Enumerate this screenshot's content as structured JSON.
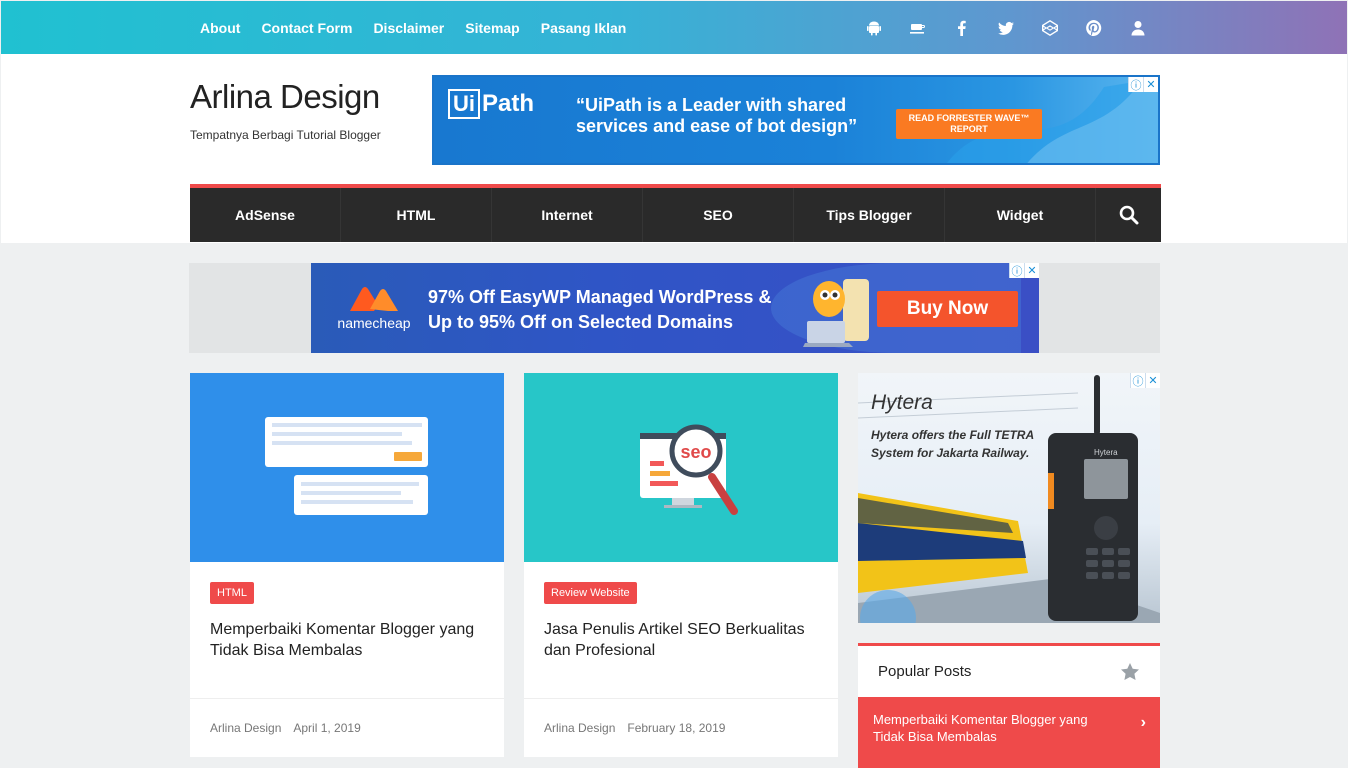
{
  "topbar": {
    "links": [
      "About",
      "Contact Form",
      "Disclaimer",
      "Sitemap",
      "Pasang Iklan"
    ],
    "social_icons": [
      "android-icon",
      "coffee-icon",
      "facebook-icon",
      "twitter-icon",
      "codepen-icon",
      "pinterest-icon",
      "user-icon"
    ]
  },
  "header": {
    "title": "Arlina Design",
    "tagline": "Tempatnya Berbagi Tutorial Blogger"
  },
  "ad_top": {
    "brand_box": "Ui",
    "brand_rest": "Path",
    "quote": "“UiPath is a Leader with shared services and ease of bot design”",
    "cta": "READ FORRESTER WAVE™ REPORT"
  },
  "mainnav": {
    "items": [
      "AdSense",
      "HTML",
      "Internet",
      "SEO",
      "Tips Blogger",
      "Widget"
    ]
  },
  "ad_wide": {
    "brand": "namecheap",
    "headline_1": "97% Off EasyWP Managed WordPress &",
    "headline_2": "Up to 95% Off on Selected Domains",
    "cta": "Buy Now"
  },
  "posts": [
    {
      "label": "HTML",
      "title": "Memperbaiki Komentar Blogger yang Tidak Bisa Membalas",
      "author": "Arlina Design",
      "date": "April 1, 2019",
      "thumb_color": "#2f8fea"
    },
    {
      "label": "Review Website",
      "title": "Jasa Penulis Artikel SEO Berkualitas dan Profesional",
      "author": "Arlina Design",
      "date": "February 18, 2019",
      "thumb_color": "#27c6c8",
      "thumb_text": "seo"
    }
  ],
  "ad_side": {
    "brand": "Hytera",
    "text": "Hytera offers the Full TETRA System for Jakarta Railway.",
    "radio_label": "Hytera"
  },
  "popular": {
    "title": "Popular Posts",
    "first_item": "Memperbaiki Komentar Blogger yang Tidak Bisa Membalas",
    "chevron": "›"
  },
  "colors": {
    "accent": "#ef4a4a",
    "nav_bg": "#2a2a2a"
  }
}
